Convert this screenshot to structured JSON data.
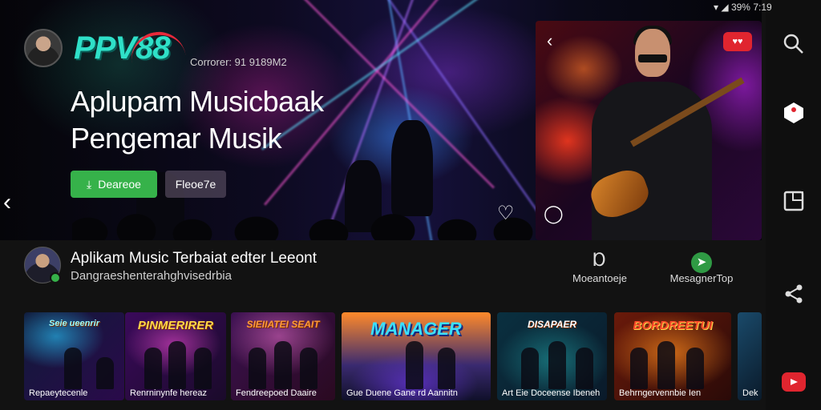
{
  "status_bar": {
    "battery": "39%",
    "time": "7:19"
  },
  "hero": {
    "brand": "PPV88",
    "tag": "Corrorer: 91 9189M2",
    "title_line1": "Aplupam Musicbaak",
    "title_line2": "Pengemar Musik",
    "primary_button": "Deareoe",
    "secondary_button": "Fleoe7e"
  },
  "side_panel": {
    "badge": "♥♥"
  },
  "info": {
    "title": "Aplikam Music Terbaiat edter Leeont",
    "subtitle": "Dangraeshenterahghvisedrbia",
    "actions": [
      {
        "label": "Moeantoeje",
        "icon": "pin-icon"
      },
      {
        "label": "MesagnerTop",
        "icon": "send-icon"
      }
    ]
  },
  "thumbnails": [
    {
      "title": "Seie ueenrir",
      "caption": "Repaeytecenle"
    },
    {
      "title": "PINMERIRER",
      "caption": "Renrninynfe hereaz"
    },
    {
      "title": "SIEIIATEI SEAIT",
      "caption": "Fendreepoed Daaire"
    },
    {
      "title": "MANAGER",
      "caption": "Gue Duene Gane rd Aannitn"
    },
    {
      "title": "DISAPAER",
      "caption": "Art Eie Doceense Ibeneh"
    },
    {
      "title": "BORDREETUI",
      "caption": "Behrngervennbie Ien"
    },
    {
      "title": "",
      "caption": "Dek"
    }
  ]
}
